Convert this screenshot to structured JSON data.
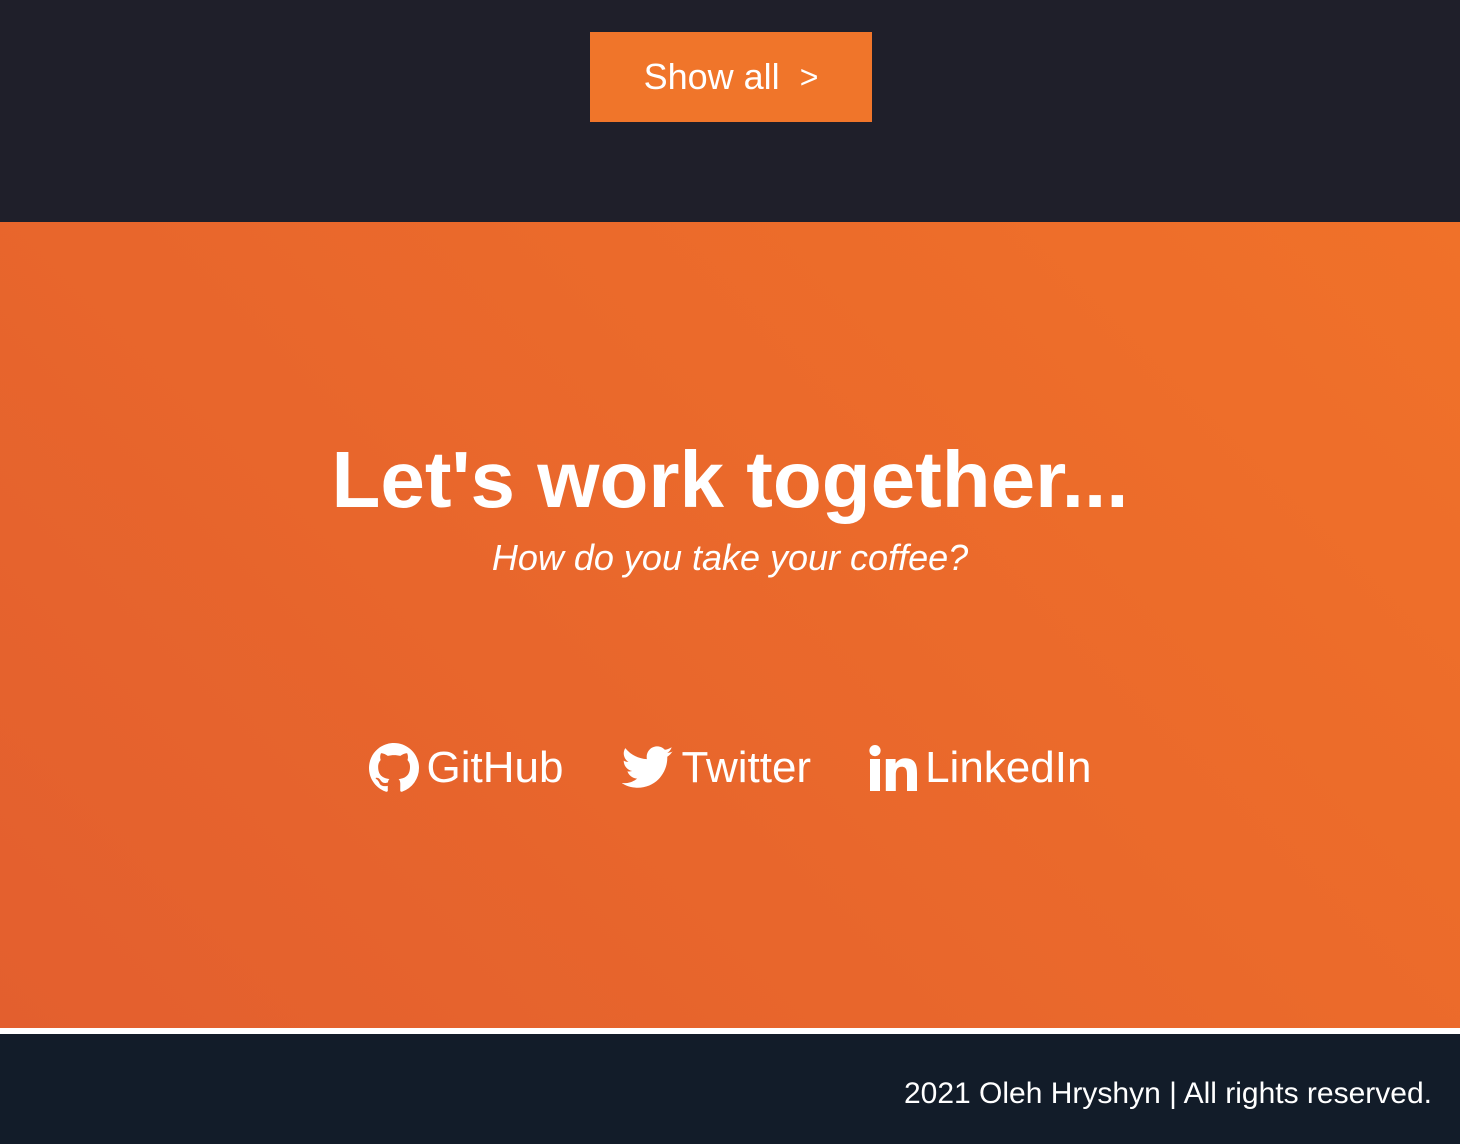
{
  "top": {
    "show_all_label": "Show all",
    "show_all_chevron": ">",
    "background": "#1f1f2a",
    "button_color": "#f0752a"
  },
  "contact": {
    "heading": "Let's work together...",
    "subheading": "How do you take your coffee?",
    "gradient": [
      "#e35f2e",
      "#f07129"
    ],
    "social": [
      {
        "label": "GitHub",
        "icon": "github-icon"
      },
      {
        "label": "Twitter",
        "icon": "twitter-icon"
      },
      {
        "label": "LinkedIn",
        "icon": "linkedin-icon"
      }
    ]
  },
  "footer": {
    "copyright": "2021 Oleh Hryshyn | All rights reserved.",
    "background": "#121c29"
  }
}
